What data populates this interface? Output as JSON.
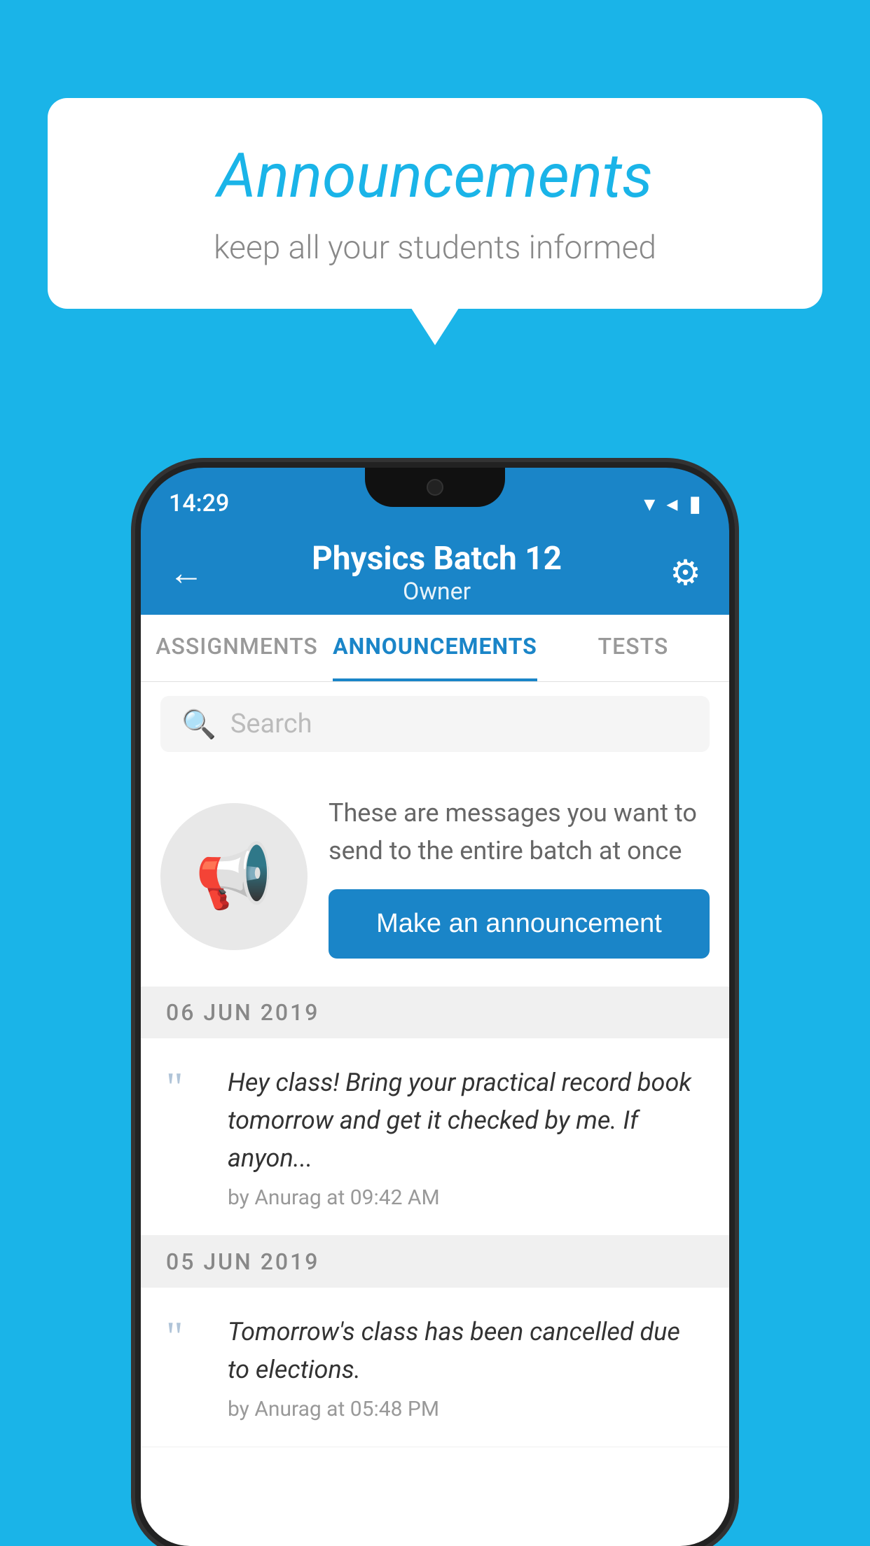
{
  "background_color": "#1ab4e8",
  "speech_bubble": {
    "title": "Announcements",
    "subtitle": "keep all your students informed"
  },
  "phone": {
    "status_bar": {
      "time": "14:29",
      "icons": [
        "wifi",
        "signal",
        "battery"
      ]
    },
    "header": {
      "title": "Physics Batch 12",
      "subtitle": "Owner",
      "back_label": "←",
      "settings_label": "⚙"
    },
    "tabs": [
      {
        "label": "ASSIGNMENTS",
        "active": false
      },
      {
        "label": "ANNOUNCEMENTS",
        "active": true
      },
      {
        "label": "TESTS",
        "active": false
      },
      {
        "label": "...",
        "active": false
      }
    ],
    "search": {
      "placeholder": "Search"
    },
    "promo": {
      "description": "These are messages you want to send to the entire batch at once",
      "button_label": "Make an announcement"
    },
    "announcements": [
      {
        "date": "06  JUN  2019",
        "text": "Hey class! Bring your practical record book tomorrow and get it checked by me. If anyon...",
        "meta": "by Anurag at 09:42 AM"
      },
      {
        "date": "05  JUN  2019",
        "text": "Tomorrow's class has been cancelled due to elections.",
        "meta": "by Anurag at 05:48 PM"
      }
    ]
  }
}
